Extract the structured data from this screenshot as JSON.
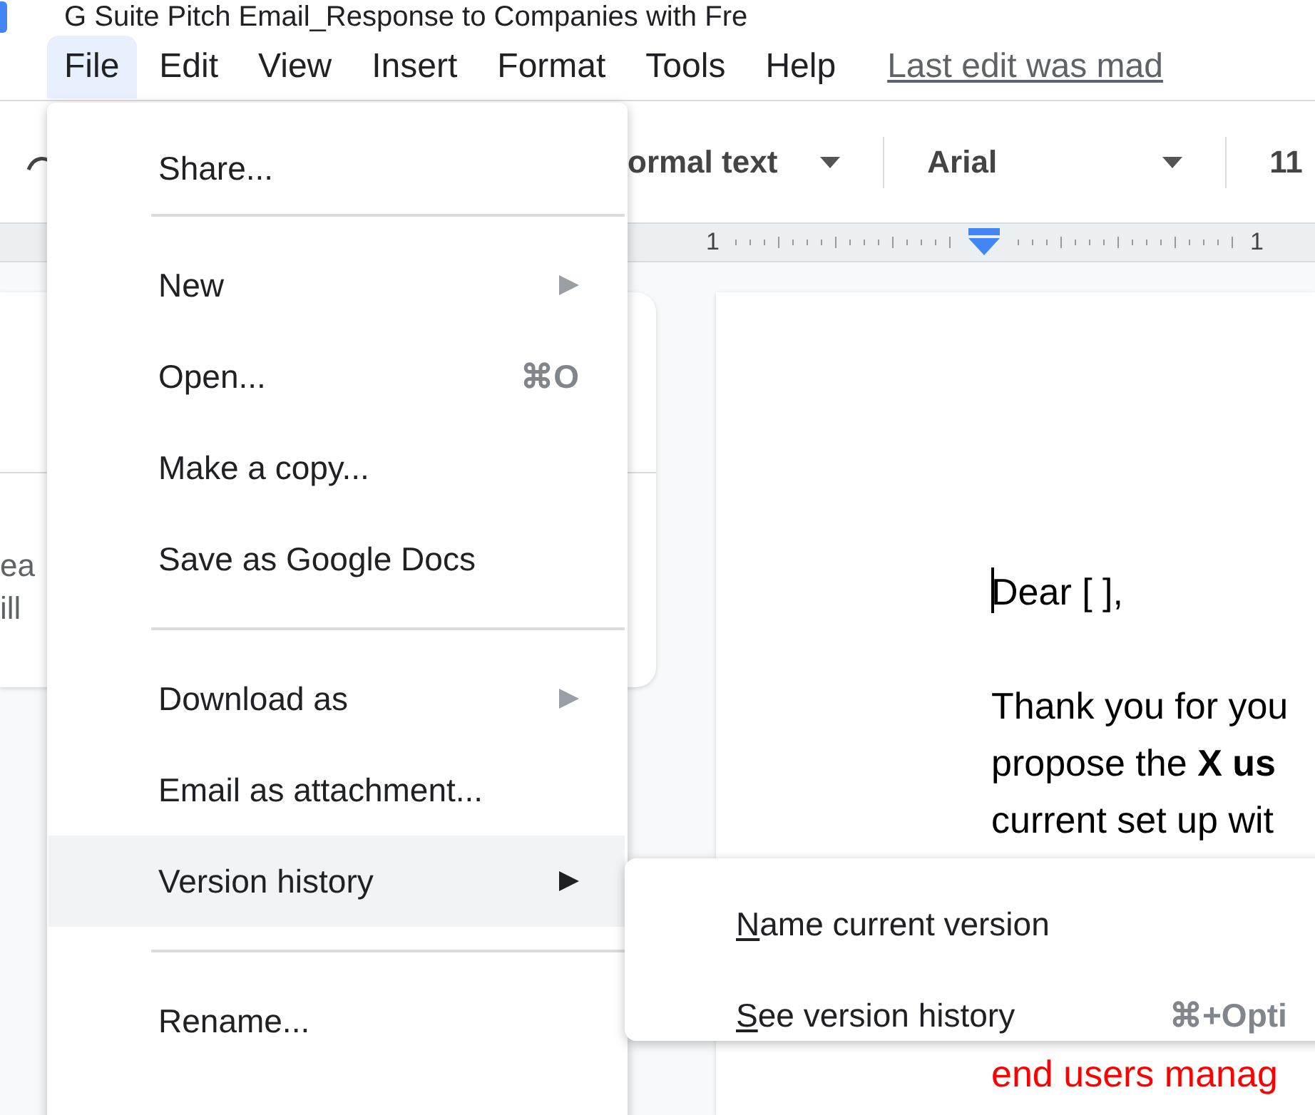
{
  "title": "G Suite Pitch Email_Response to Companies with Fre",
  "menubar": {
    "items": [
      {
        "label": "File",
        "selected": true
      },
      {
        "label": "Edit",
        "selected": false
      },
      {
        "label": "View",
        "selected": false
      },
      {
        "label": "Insert",
        "selected": false
      },
      {
        "label": "Format",
        "selected": false
      },
      {
        "label": "Tools",
        "selected": false
      },
      {
        "label": "Help",
        "selected": false
      }
    ],
    "last_edit": "Last edit was mad"
  },
  "toolbar": {
    "style": "ormal text",
    "font": "Arial",
    "size": "11"
  },
  "ruler": {
    "labels": [
      "1",
      "1"
    ]
  },
  "outline_panel": {
    "lines": [
      "ea",
      "ill"
    ]
  },
  "document": {
    "paragraphs": [
      {
        "color": "#000000",
        "lines": [
          "Dear [  ],"
        ]
      },
      {
        "color": "#000000",
        "lines": [
          "Thank you for you",
          "propose the **X us**",
          "current set up wit"
        ]
      },
      {
        "color": "#ff0000",
        "lines": [
          "end users manag"
        ]
      }
    ]
  },
  "file_menu": {
    "items": [
      {
        "kind": "item",
        "label": "Share...",
        "selected": false
      },
      {
        "kind": "divider"
      },
      {
        "kind": "item",
        "label": "New",
        "submenu": true,
        "selected": false
      },
      {
        "kind": "item",
        "label": "Open...",
        "shortcut": "⌘O",
        "selected": false
      },
      {
        "kind": "item",
        "label": "Make a copy...",
        "selected": false
      },
      {
        "kind": "item",
        "label": "Save as Google Docs",
        "selected": false
      },
      {
        "kind": "divider"
      },
      {
        "kind": "item",
        "label": "Download as",
        "submenu": true,
        "selected": false
      },
      {
        "kind": "item",
        "label": "Email as attachment...",
        "selected": false
      },
      {
        "kind": "item",
        "label": "Version history",
        "submenu": true,
        "selected": true
      },
      {
        "kind": "divider"
      },
      {
        "kind": "item",
        "label": "Rename...",
        "selected": false
      }
    ]
  },
  "submenu": {
    "items": [
      {
        "label": "Name current version",
        "underline_first": true
      },
      {
        "label": "See version history",
        "shortcut": "⌘+Opti",
        "underline_first": true
      }
    ]
  }
}
